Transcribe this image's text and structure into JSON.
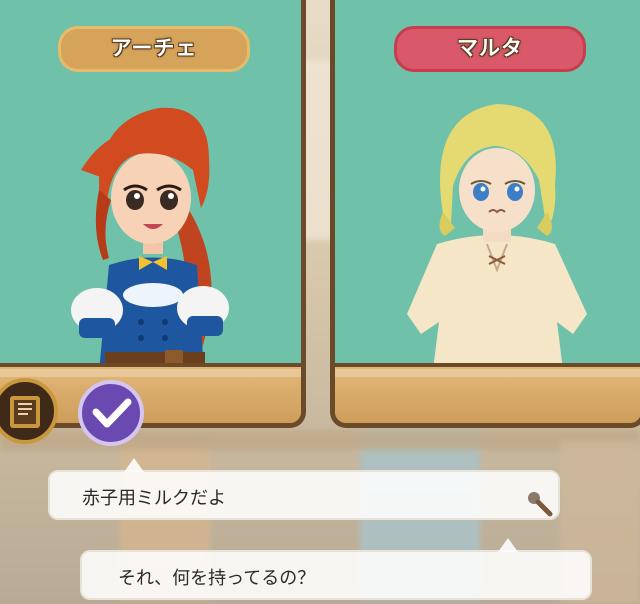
{
  "characters": {
    "left": {
      "name": "アーチェ",
      "tag_color": "#d6a35b"
    },
    "right": {
      "name": "マルタ",
      "tag_color": "#d9596a"
    }
  },
  "buttons": {
    "diary": {
      "icon": "diary-icon"
    },
    "give": {
      "icon": "checkmark-icon"
    }
  },
  "dialogue": {
    "player_line": "赤子用ミルクだよ",
    "npc_line": "それ、何を持ってるの？"
  },
  "colors": {
    "panel_bg": "#6fc2a9",
    "panel_border": "#6b4a2a",
    "floor": "#d9a864"
  }
}
